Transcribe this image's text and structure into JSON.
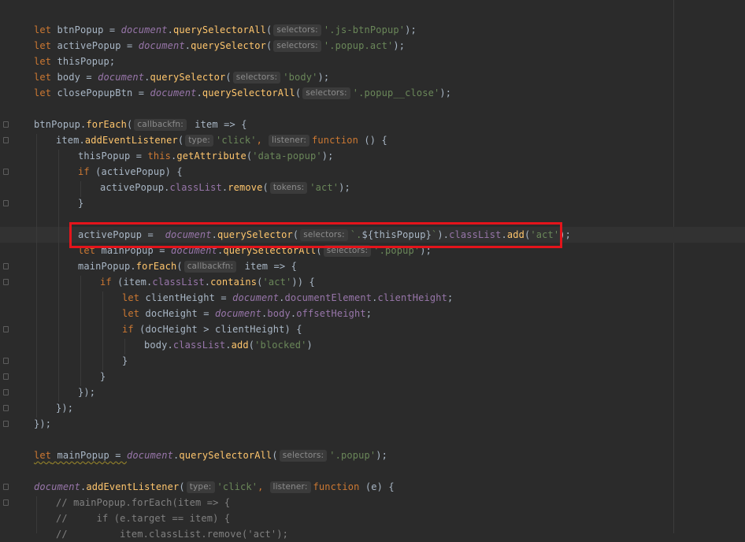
{
  "code": {
    "l1": {
      "kw": "let",
      "v1": " btnPopup = ",
      "doc": "document",
      "dot": ".",
      "fn": "querySelectorAll",
      "p": "(",
      "hint": "selectors:",
      "str": "'.js-btnPopup'",
      "end": ");"
    },
    "l2": {
      "kw": "let",
      "v1": " activePopup = ",
      "doc": "document",
      "dot": ".",
      "fn": "querySelector",
      "p": "(",
      "hint": "selectors:",
      "str": "'.popup.act'",
      "end": ");"
    },
    "l3": {
      "kw": "let",
      "v1": " thisPopup;"
    },
    "l4": {
      "kw": "let",
      "v1": " body = ",
      "doc": "document",
      "dot": ".",
      "fn": "querySelector",
      "p": "(",
      "hint": "selectors:",
      "str": "'body'",
      "end": ");"
    },
    "l5": {
      "kw": "let",
      "v1": " closePopupBtn = ",
      "doc": "document",
      "dot": ".",
      "fn": "querySelectorAll",
      "p": "(",
      "hint": "selectors:",
      "str": "'.popup__close'",
      "end": ");"
    },
    "l7": {
      "v1": "btnPopup.",
      "fn": "forEach",
      "p": "(",
      "hint": "callbackfn:",
      "v2": " item => {"
    },
    "l8": {
      "v1": "item.",
      "fn": "addEventListener",
      "p": "(",
      "hint1": "type:",
      "str": "'click'",
      "comma": ",",
      "hint2": "listener:",
      "kw": "function",
      "v2": " () {"
    },
    "l9": {
      "v1": "thisPopup = ",
      "kw": "this",
      "dot": ".",
      "fn": "getAttribute",
      "p": "(",
      "str": "'data-popup'",
      "end": ");"
    },
    "l10": {
      "kw": "if",
      "v1": " (activePopup) {"
    },
    "l11": {
      "v1": "activePopup.",
      "prop": "classList",
      "dot": ".",
      "fn": "remove",
      "p": "(",
      "hint": "tokens:",
      "str": "'act'",
      "end": ");"
    },
    "l12": {
      "v1": "}"
    },
    "l14": {
      "v1": "activePopup = ",
      "doc": "document",
      "dot": ".",
      "fn": "querySelector",
      "p": "(",
      "hint": "selectors:",
      "str1": "`.",
      "tpl": "${thisPopup}",
      "str2": "`",
      "v2": ").",
      "prop": "classList",
      "dot2": ".",
      "fn2": "add",
      "p2": "(",
      "str3": "'act'",
      "end": ");"
    },
    "l15": {
      "kw": "let",
      "v1": " mainPopup = ",
      "doc": "document",
      "dot": ".",
      "fn": "querySelectorAll",
      "p": "(",
      "hint": "selectors:",
      "str": "'.popup'",
      "end": ");"
    },
    "l16": {
      "v1": "mainPopup.",
      "fn": "forEach",
      "p": "(",
      "hint": "callbackfn:",
      "v2": " item => {"
    },
    "l17": {
      "kw": "if",
      "v1": " (item.",
      "prop": "classList",
      "dot": ".",
      "fn": "contains",
      "p": "(",
      "str": "'act'",
      "end": ")) {"
    },
    "l18": {
      "kw": "let",
      "v1": " clientHeight = ",
      "doc": "document",
      "dot": ".",
      "prop1": "documentElement",
      "dot2": ".",
      "prop2": "clientHeight",
      "end": ";"
    },
    "l19": {
      "kw": "let",
      "v1": " docHeight = ",
      "doc": "document",
      "dot": ".",
      "prop1": "body",
      "dot2": ".",
      "prop2": "offsetHeight",
      "end": ";"
    },
    "l20": {
      "kw": "if",
      "v1": " (docHeight > clientHeight) {"
    },
    "l21": {
      "v1": "body.",
      "prop": "classList",
      "dot": ".",
      "fn": "add",
      "p": "(",
      "str": "'blocked'",
      "end": ")"
    },
    "l22": {
      "v1": "}"
    },
    "l23": {
      "v1": "}"
    },
    "l24": {
      "v1": "});"
    },
    "l25": {
      "v1": "});"
    },
    "l26": {
      "v1": "});"
    },
    "l28": {
      "kw": "let",
      "v1": " mainPopup = ",
      "doc": "document",
      "dot": ".",
      "fn": "querySelectorAll",
      "p": "(",
      "hint": "selectors:",
      "str": "'.popup'",
      "end": ");"
    },
    "l30": {
      "doc": "document",
      "dot": ".",
      "fn": "addEventListener",
      "p": "(",
      "hint1": "type:",
      "str": "'click'",
      "comma": ",",
      "hint2": "listener:",
      "kw": "function",
      "v2": " (e) {"
    },
    "l31": {
      "cmt": "// mainPopup.forEach(item => {"
    },
    "l32": {
      "cmt": "//     if (e.target == item) {"
    },
    "l33": {
      "cmt": "//         item.classList.remove('act');"
    }
  }
}
